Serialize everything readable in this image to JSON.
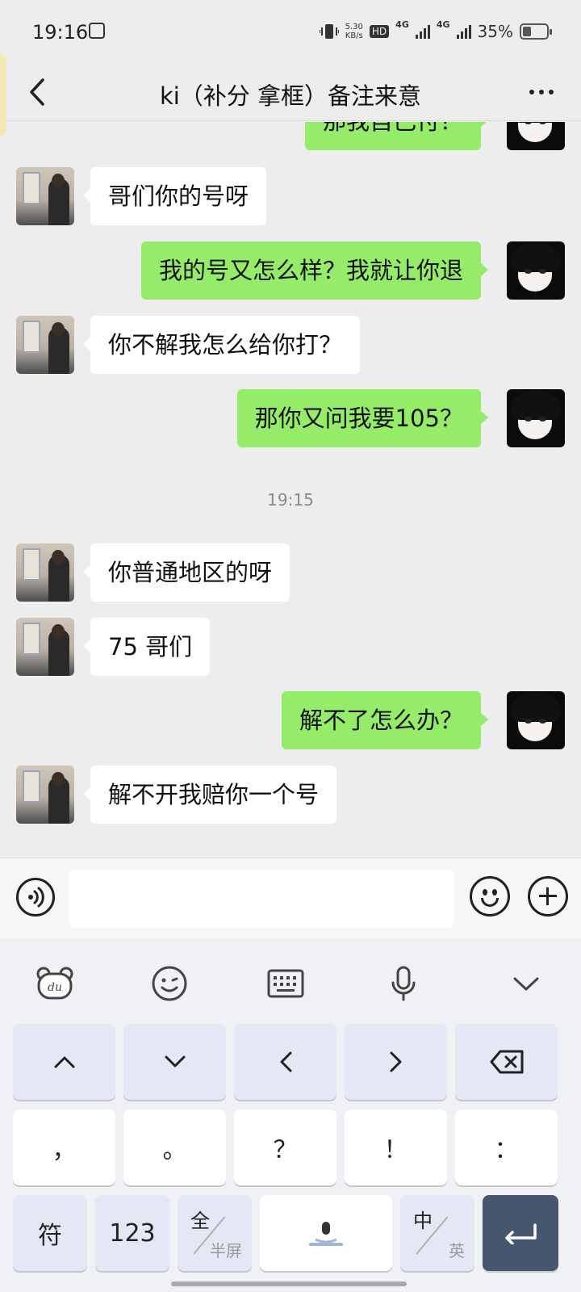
{
  "status_bar": {
    "time": "19:16",
    "net_speed_value": "5.30",
    "net_speed_unit": "KB/s",
    "hd_label": "HD",
    "network_1": "4G",
    "network_2": "4G",
    "battery_percent": "35%",
    "battery_level": 0.35
  },
  "nav": {
    "title": "ki（补分  拿框）备注来意"
  },
  "messages": [
    {
      "side": "right",
      "text": "那我自己付？",
      "partial": true
    },
    {
      "side": "left",
      "text": "哥们你的号呀"
    },
    {
      "side": "right",
      "text": "我的号又怎么样？我就让你退"
    },
    {
      "side": "left",
      "text": "你不解我怎么给你打？"
    },
    {
      "side": "right",
      "text": "那你又问我要105？"
    },
    {
      "type": "time",
      "text": "19:15"
    },
    {
      "side": "left",
      "text": "你普通地区的呀"
    },
    {
      "side": "left",
      "text": "75 哥们"
    },
    {
      "side": "right",
      "text": "解不了怎么办？"
    },
    {
      "side": "left",
      "text": "解不开我赔你一个号"
    }
  ],
  "input": {
    "placeholder": ""
  },
  "keyboard": {
    "toolbar_icons": [
      "du-bear-icon",
      "emoji-icon",
      "keyboard-icon",
      "mic-icon",
      "chevron-down-icon"
    ],
    "nav_keys": [
      "arrow-up-icon",
      "arrow-down-icon",
      "arrow-left-icon",
      "arrow-right-icon",
      "backspace-icon"
    ],
    "punct_keys": [
      "，",
      "。",
      "？",
      "！",
      "："
    ],
    "bottom": {
      "symbols": "符",
      "numbers": "123",
      "fullwidth_top": "全",
      "fullwidth_bottom": "半屏",
      "lang_top": "中",
      "lang_bottom": "英"
    }
  }
}
